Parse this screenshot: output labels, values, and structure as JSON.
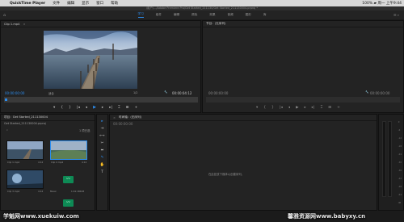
{
  "menubar": {
    "apple": "",
    "app_name": "QuickTime Player",
    "menus": [
      "文件",
      "编辑",
      "显示",
      "窗口",
      "帮助"
    ],
    "status_right": "100% ▰  周一 上午9:44"
  },
  "window": {
    "title": "/用户/…/Adobe Premiere Pro/Get Started_211130/Get Started_211130004.prproj *"
  },
  "workspaces": {
    "home_icon": "⌂",
    "tabs": [
      "学习",
      "组件",
      "编辑",
      "颜色",
      "效果",
      "音频",
      "图形",
      "库"
    ],
    "active_index": 0,
    "right_icons": "☰  ⌕"
  },
  "source_panel": {
    "tab": "Clip 1.mp4",
    "tab_close": "×",
    "timecode_left": "00:00:00:00",
    "fit_label": "适合",
    "fraction": "1/2",
    "timecode_right": "00:00:04:12",
    "controls": [
      "▾",
      "{",
      "}",
      "|◂",
      "◂",
      "▶",
      "▸",
      "▸|",
      "⌶",
      "⊞",
      "+"
    ]
  },
  "program_panel": {
    "tab": "节目：(无序列)",
    "timecode_left": "00:00:00:00",
    "timecode_right": "00:00:00:00",
    "controls": [
      "▾",
      "{",
      "}",
      "|◂",
      "◂",
      "▶",
      "▸",
      "▸|",
      "⌶",
      "⊞",
      "+"
    ]
  },
  "project_panel": {
    "tab": "项目：Get Started_211130004",
    "path": "Get Started_211130004.prproj",
    "item_count": "1 项已选",
    "clips": [
      {
        "name": "Clip 1.mp4",
        "duration": "4:12"
      },
      {
        "name": "Clip 2.mp4",
        "duration": "4:12"
      },
      {
        "name": "Clip 3.mp4",
        "duration": "4:12"
      },
      {
        "name": "Music",
        "duration": "1:41:18418"
      }
    ]
  },
  "timeline_panel": {
    "tab": "时间轴：(无序列)",
    "timecode": "00:00:00:00",
    "empty_message": "在此处放下媒体以创建序列。"
  },
  "tools": [
    "▸",
    "⇥",
    "⟷",
    "✂",
    "⬌",
    "✎",
    "✋",
    "T"
  ],
  "meter": {
    "scale": [
      "0",
      "-6",
      "-12",
      "-18",
      "-24",
      "-30",
      "-36",
      "-42",
      "-48",
      "-54",
      "dB"
    ]
  },
  "watermarks": {
    "left": "学魁网www.xuekuiw.com",
    "right": "馨雅资源网www.babyxy.cn"
  }
}
